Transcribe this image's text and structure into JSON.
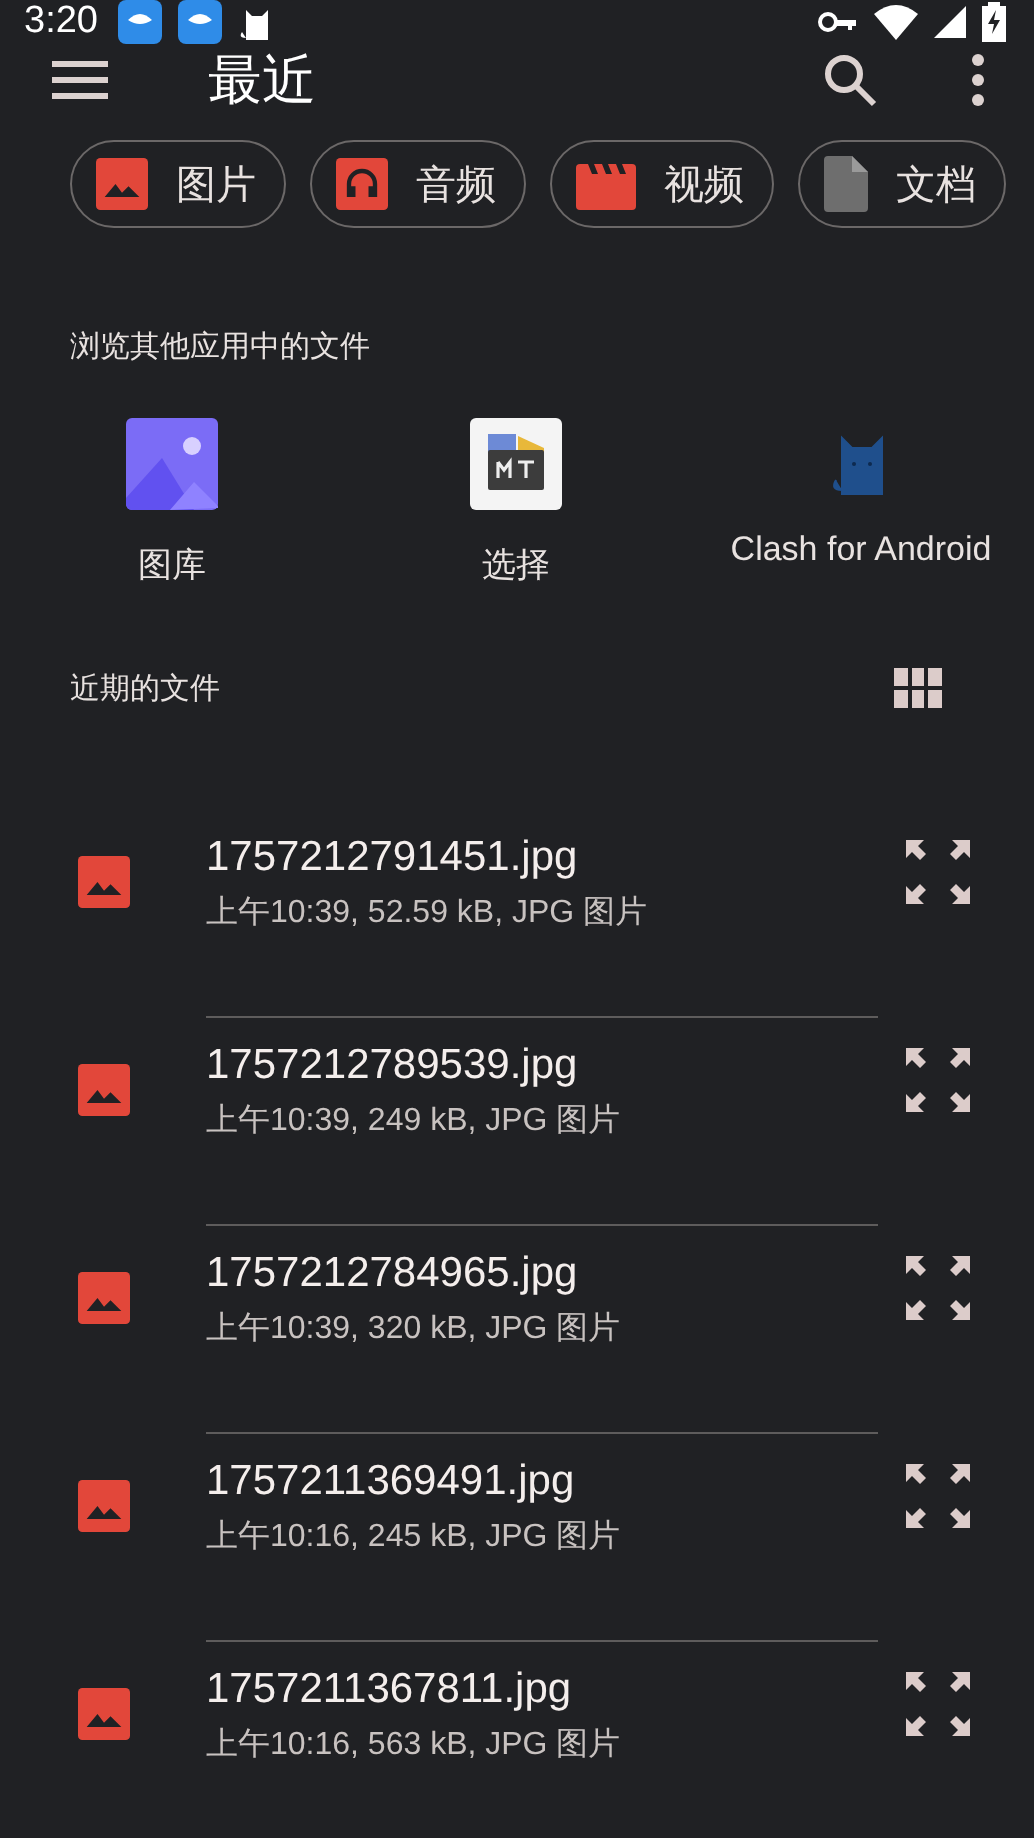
{
  "status_bar": {
    "time": "3:20"
  },
  "toolbar": {
    "title": "最近"
  },
  "chips": [
    {
      "label": "图片",
      "kind": "image"
    },
    {
      "label": "音频",
      "kind": "audio"
    },
    {
      "label": "视频",
      "kind": "video"
    },
    {
      "label": "文档",
      "kind": "document"
    }
  ],
  "browse_section": {
    "heading": "浏览其他应用中的文件",
    "apps": [
      {
        "label": "图库",
        "kind": "gallery"
      },
      {
        "label": "选择",
        "kind": "mt"
      },
      {
        "label": "Clash for Android",
        "kind": "cat"
      }
    ]
  },
  "recent_section": {
    "heading": "近期的文件"
  },
  "files": [
    {
      "name": "1757212791451.jpg",
      "details": "上午10:39, 52.59 kB, JPG 图片"
    },
    {
      "name": "1757212789539.jpg",
      "details": "上午10:39, 249 kB, JPG 图片"
    },
    {
      "name": "1757212784965.jpg",
      "details": "上午10:39, 320 kB, JPG 图片"
    },
    {
      "name": "1757211369491.jpg",
      "details": "上午10:16, 245 kB, JPG 图片"
    },
    {
      "name": "1757211367811.jpg",
      "details": "上午10:16, 563 kB, JPG 图片"
    }
  ]
}
